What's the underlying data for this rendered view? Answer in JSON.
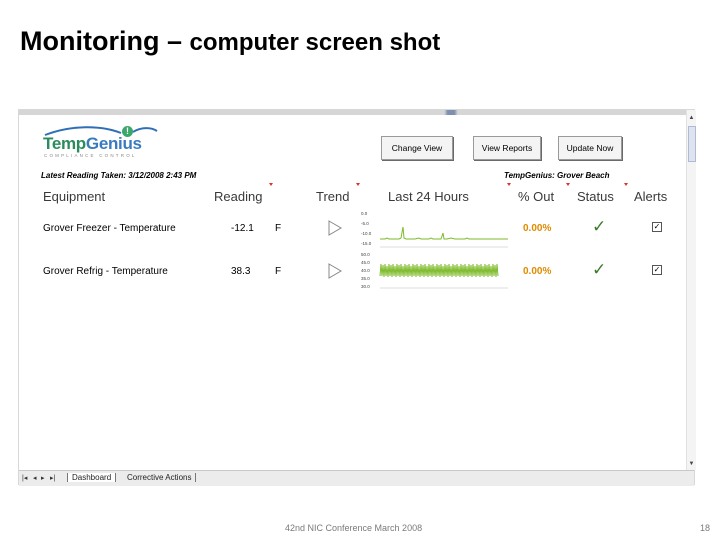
{
  "slide": {
    "title_main": "Monitoring",
    "title_dash": " – ",
    "title_rest": "computer screen shot",
    "footer": "42nd NIC Conference March 2008",
    "page_number": "18"
  },
  "app": {
    "logo_text_a": "Temp",
    "logo_text_b": "Genius",
    "logo_tagline": "COMPLIANCE CONTROL",
    "buttons": {
      "change_view": "Change View",
      "view_reports": "View Reports",
      "update_now": "Update Now"
    },
    "latest_reading": "Latest Reading Taken: 3/12/2008 2:43 PM",
    "site_name": "TempGenius: Grover Beach",
    "headers": {
      "equipment": "Equipment",
      "reading": "Reading",
      "trend": "Trend",
      "last24": "Last 24 Hours",
      "pct_out": "% Out",
      "status": "Status",
      "alerts": "Alerts"
    },
    "rows": [
      {
        "name": "Grover Freezer - Temperature",
        "reading": "-12.1",
        "unit": "F",
        "pct_out": "0.00%",
        "status": "✓",
        "alert": "☑",
        "axis_labels": [
          "0.0",
          "-5.0",
          "-10.0",
          "-15.0"
        ]
      },
      {
        "name": "Grover Refrig - Temperature",
        "reading": "38.3",
        "unit": "F",
        "pct_out": "0.00%",
        "status": "✓",
        "alert": "☑",
        "axis_labels": [
          "50.0",
          "45.0",
          "40.0",
          "35.0",
          "30.0"
        ]
      }
    ],
    "tabs": {
      "dashboard": "Dashboard",
      "corrective": "Corrective Actions"
    },
    "tab_nav": [
      "|◂",
      "◂",
      "▸",
      "▸|"
    ],
    "colors": {
      "pct_out": "#e08a00",
      "sparkline": "#7dbb2a",
      "status": "#3c7a2a",
      "sort_marker": "#d9342b"
    },
    "icons": {
      "trend": "play-triangle-icon",
      "status": "check-icon",
      "alerts": "checkbox-icon"
    }
  }
}
